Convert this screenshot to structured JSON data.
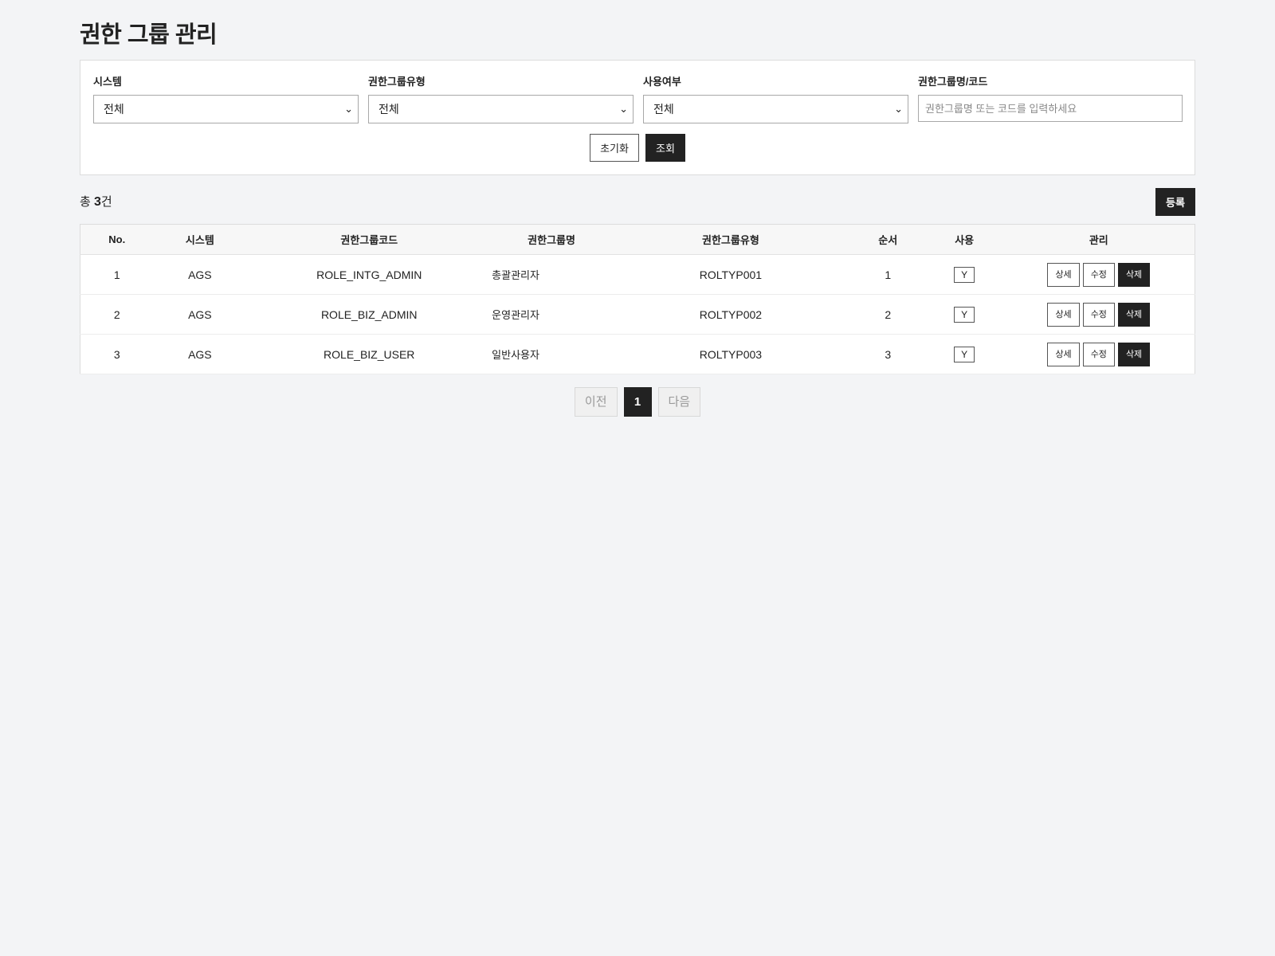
{
  "page": {
    "title": "권한 그룹 관리"
  },
  "search": {
    "system": {
      "label": "시스템",
      "value": "전체"
    },
    "group_type": {
      "label": "권한그룹유형",
      "value": "전체"
    },
    "use_yn": {
      "label": "사용여부",
      "value": "전체"
    },
    "keyword": {
      "label": "권한그룹명/코드",
      "value": "",
      "placeholder": "권한그룹명 또는 코드를 입력하세요"
    },
    "reset_label": "초기화",
    "search_label": "조회"
  },
  "summary": {
    "prefix": "총 ",
    "count": "3",
    "suffix": "건"
  },
  "register_label": "등록",
  "table": {
    "headers": [
      "No.",
      "시스템",
      "권한그룹코드",
      "권한그룹명",
      "권한그룹유형",
      "순서",
      "사용",
      "관리"
    ],
    "rows": [
      {
        "no": "1",
        "system": "AGS",
        "code": "ROLE_INTG_ADMIN",
        "name": "총괄관리자",
        "type": "ROLTYP001",
        "order": "1",
        "use": "Y"
      },
      {
        "no": "2",
        "system": "AGS",
        "code": "ROLE_BIZ_ADMIN",
        "name": "운영관리자",
        "type": "ROLTYP002",
        "order": "2",
        "use": "Y"
      },
      {
        "no": "3",
        "system": "AGS",
        "code": "ROLE_BIZ_USER",
        "name": "일반사용자",
        "type": "ROLTYP003",
        "order": "3",
        "use": "Y"
      }
    ],
    "actions": {
      "detail": "상세",
      "edit": "수정",
      "delete": "삭제"
    }
  },
  "pagination": {
    "prev": "이전",
    "current": "1",
    "next": "다음"
  },
  "icons": {
    "select_arrow": "chevron-down-icon"
  }
}
